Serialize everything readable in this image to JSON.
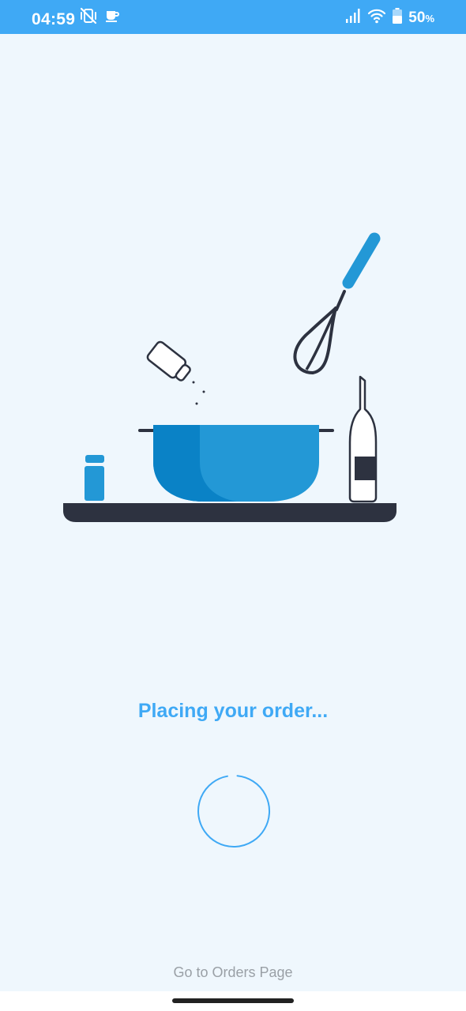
{
  "status_bar": {
    "time": "04:59",
    "battery_level": "50",
    "battery_unit": "%",
    "icons": [
      "vibrate-off-icon",
      "coffee-cup-icon",
      "signal-icon",
      "wifi-icon",
      "battery-icon"
    ]
  },
  "illustration": {
    "name": "cooking-pot-illustration",
    "colors": {
      "pot": "#2398d6",
      "pot_shadow": "#0a82c6",
      "counter": "#2d3240",
      "accent": "#2398d6"
    }
  },
  "status_message": "Placing your order...",
  "orders_link": "Go to Orders Page",
  "colors": {
    "status_bar": "#3fa9f5",
    "background": "#eff7fd",
    "accent": "#3fa9f5",
    "link": "#9aa0a6"
  }
}
